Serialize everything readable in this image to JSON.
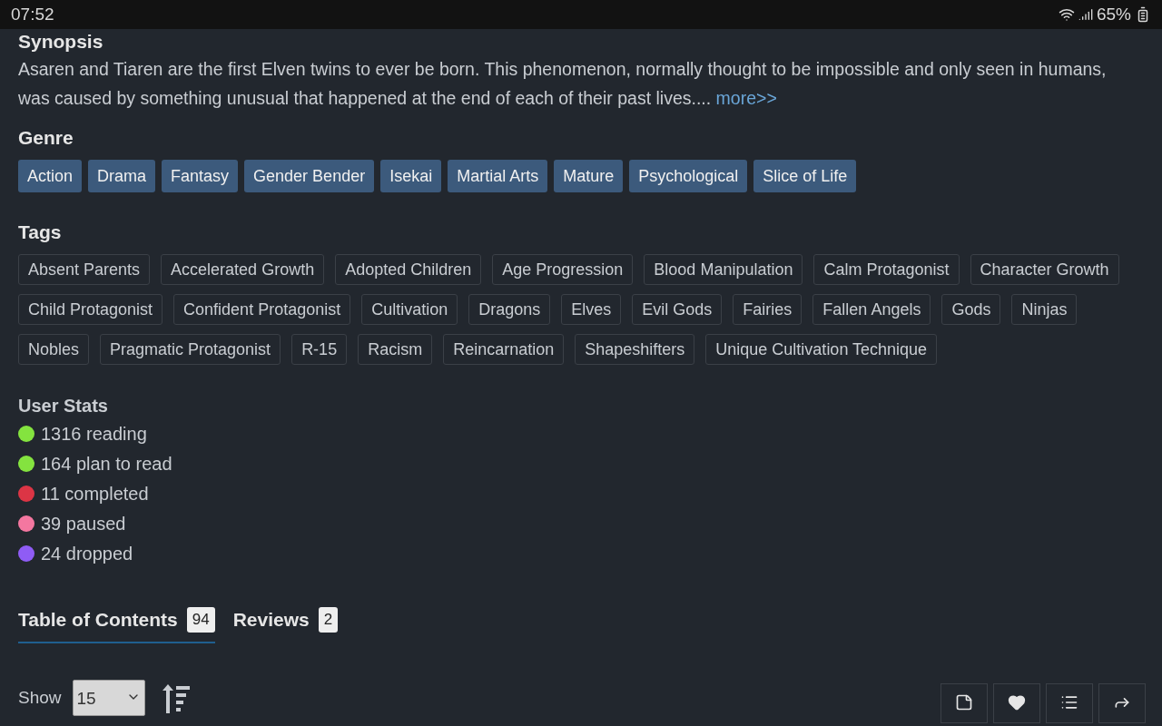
{
  "status_bar": {
    "time": "07:52",
    "battery": "65%"
  },
  "synopsis": {
    "heading": "Synopsis",
    "text": "Asaren and Tiaren are the first Elven twins to ever be born. This phenomenon, normally thought to be impossible and only seen in humans, was caused by something unusual that happened at the end of each of their past lives....",
    "more": "more>>"
  },
  "genre": {
    "heading": "Genre",
    "items": [
      "Action",
      "Drama",
      "Fantasy",
      "Gender Bender",
      "Isekai",
      "Martial Arts",
      "Mature",
      "Psychological",
      "Slice of Life"
    ]
  },
  "tags": {
    "heading": "Tags",
    "items": [
      "Absent Parents",
      "Accelerated Growth",
      "Adopted Children",
      "Age Progression",
      "Blood Manipulation",
      "Calm Protagonist",
      "Character Growth",
      "Child Protagonist",
      "Confident Protagonist",
      "Cultivation",
      "Dragons",
      "Elves",
      "Evil Gods",
      "Fairies",
      "Fallen Angels",
      "Gods",
      "Ninjas",
      "Nobles",
      "Pragmatic Protagonist",
      "R-15",
      "Racism",
      "Reincarnation",
      "Shapeshifters",
      "Unique Cultivation Technique"
    ]
  },
  "user_stats": {
    "heading": "User Stats",
    "items": [
      {
        "label": "1316 reading",
        "color": "#84e33f"
      },
      {
        "label": "164 plan to read",
        "color": "#84e33f"
      },
      {
        "label": "11 completed",
        "color": "#dc3545"
      },
      {
        "label": "39 paused",
        "color": "#f477a0"
      },
      {
        "label": "24 dropped",
        "color": "#8f5cf5"
      }
    ]
  },
  "tabs": [
    {
      "label": "Table of Contents",
      "count": "94",
      "selected": true
    },
    {
      "label": "Reviews",
      "count": "2",
      "selected": false
    }
  ],
  "toc": {
    "show_label": "Show",
    "page_size": "15"
  }
}
